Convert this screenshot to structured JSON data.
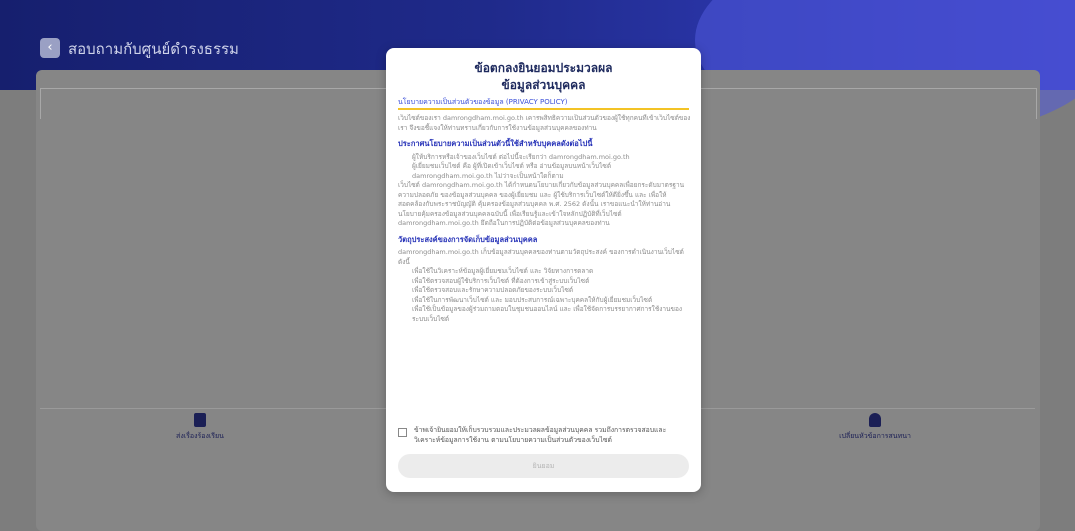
{
  "header": {
    "title": "สอบถามกับศูนย์ดำรงธรรม",
    "back_icon": "chevron-left-icon"
  },
  "footer": {
    "left_label": "ส่งเรื่องร้องเรียน",
    "right_label": "เปลี่ยนหัวข้อการสนทนา",
    "left_icon": "document-icon",
    "right_icon": "user-icon"
  },
  "modal": {
    "title_line1": "ข้อตกลงยินยอมประมวลผล",
    "title_line2": "ข้อมูลส่วนบุคคล",
    "policy_link": "นโยบายความเป็นส่วนตัวของข้อมูล (PRIVACY POLICY)",
    "paragraph1": "เว็บไซต์ของเรา damrongdham.moi.go.th เคารพสิทธิความเป็นส่วนตัวของผู้ใช้ทุกคนที่เข้าเว็บไซต์ของเรา จึงขอชี้แจงให้ท่านทราบเกี่ยวกับการใช้งานข้อมูลส่วนบุคคลของท่าน",
    "heading1": "ประกาศนโยบายความเป็นส่วนตัวนี้ใช้สำหรับบุคคลดังต่อไปนี้",
    "list1_item1": "ผู้ให้บริการหรือเจ้าของเว็บไซต์ ต่อไปนี้จะเรียกว่า damrongdham.moi.go.th",
    "list1_item2": "ผู้เยี่ยมชมเว็บไซต์ คือ ผู้ที่เปิดเข้าเว็บไซต์ หรือ อ่านข้อมูลบนหน้าเว็บไซต์ damrongdham.moi.go.th ไม่ว่าจะเป็นหน้าใดก็ตาม",
    "paragraph2": "เว็บไซต์ damrongdham.moi.go.th ได้กำหนดนโยบายเกี่ยวกับข้อมูลส่วนบุคคลเพื่อยกระดับมาตรฐาน ความปลอดภัย ของข้อมูลส่วนบุคคล ของผู้เยี่ยมชม และ ผู้ใช้บริการเว็บไซต์ให้ดียิ่งขึ้น และ เพื่อให้สอดคล้องกับพระราชบัญญัติ คุ้มครองข้อมูลส่วนบุคคล พ.ศ. 2562 ดังนั้น เราขอแนะนำให้ท่านอ่านนโยบายคุ้มครองข้อมูลส่วนบุคคลฉบับนี้ เพื่อเรียนรู้และเข้าใจหลักปฏิบัติที่เว็บไซต์ damrongdham.moi.go.th ยึดถือในการปฏิบัติต่อข้อมูลส่วนบุคคลของท่าน",
    "heading2": "วัตถุประสงค์ของการจัดเก็บข้อมูลส่วนบุคคล",
    "paragraph3": "damrongdham.moi.go.th เก็บข้อมูลส่วนบุคคลของท่านตามวัตถุประสงค์ ของการดำเนินงานเว็บไซต์ดังนี้",
    "list2": [
      "เพื่อใช้ในวิเคราะห์ข้อมูลผู้เยี่ยมชมเว็บไซต์ และ วิจัยทางการตลาด",
      "เพื่อใช้ตรวจสอบผู้ใช้บริการเว็บไซต์ ที่ต้องการเข้าสู่ระบบเว็บไซต์",
      "เพื่อใช้ตรวจสอบและรักษาความปลอดภัยของระบบเว็บไซต์",
      "เพื่อใช้ในการพัฒนาเว็บไซต์ และ มอบประสบการณ์เฉพาะบุคคลให้กับผู้เยี่ยมชมเว็บไซต์",
      "เพื่อใช้เป็นข้อมูลของผู้ร่วมถามตอบในชุมชนออนไลน์ และ เพื่อใช้จัดการบรรยากาศการใช้งานของระบบเว็บไซต์"
    ],
    "consent_text": "ข้าพเจ้ายินยอมให้เก็บรวบรวมและประมวลผลข้อมูลส่วนบุคคล รวมถึงการตรวจสอบและวิเคราะห์ข้อมูลการใช้งาน ตามนโยบายความเป็นส่วนตัวของเว็บไซต์",
    "accept_label": "ยินยอม"
  }
}
